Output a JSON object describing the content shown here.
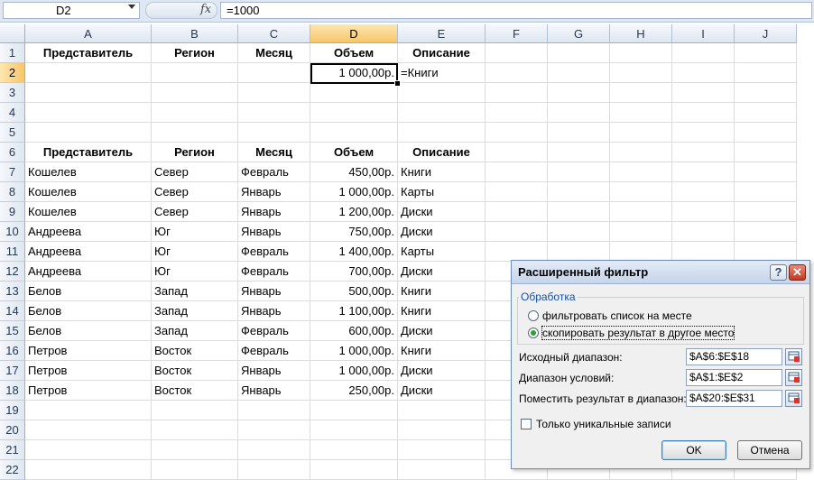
{
  "formula_bar": {
    "name_box": "D2",
    "fx_icon": "fx",
    "formula": "=1000"
  },
  "columns": [
    {
      "label": "A",
      "w": 140
    },
    {
      "label": "B",
      "w": 96
    },
    {
      "label": "C",
      "w": 80
    },
    {
      "label": "D",
      "w": 97
    },
    {
      "label": "E",
      "w": 97
    },
    {
      "label": "F",
      "w": 69
    },
    {
      "label": "G",
      "w": 69
    },
    {
      "label": "H",
      "w": 69
    },
    {
      "label": "I",
      "w": 69
    },
    {
      "label": "J",
      "w": 69
    }
  ],
  "active_column": "D",
  "active_row": 2,
  "rows": [
    {
      "num": "1",
      "bold": true,
      "cells": [
        "Представитель",
        "Регион",
        "Месяц",
        "Объем",
        "Описание"
      ]
    },
    {
      "num": "2",
      "cells": [
        "",
        "",
        "",
        "1 000,00р.",
        "=Книги"
      ]
    },
    {
      "num": "3",
      "cells": [
        "",
        "",
        "",
        "",
        ""
      ]
    },
    {
      "num": "4",
      "cells": [
        "",
        "",
        "",
        "",
        ""
      ]
    },
    {
      "num": "5",
      "cells": [
        "",
        "",
        "",
        "",
        ""
      ]
    },
    {
      "num": "6",
      "bold": true,
      "cells": [
        "Представитель",
        "Регион",
        "Месяц",
        "Объем",
        "Описание"
      ]
    },
    {
      "num": "7",
      "cells": [
        "Кошелев",
        "Север",
        "Февраль",
        "450,00р.",
        "Книги"
      ]
    },
    {
      "num": "8",
      "cells": [
        "Кошелев",
        "Север",
        "Январь",
        "1 000,00р.",
        "Карты"
      ]
    },
    {
      "num": "9",
      "cells": [
        "Кошелев",
        "Север",
        "Январь",
        "1 200,00р.",
        "Диски"
      ]
    },
    {
      "num": "10",
      "cells": [
        "Андреева",
        "Юг",
        "Январь",
        "750,00р.",
        "Диски"
      ]
    },
    {
      "num": "11",
      "cells": [
        "Андреева",
        "Юг",
        "Февраль",
        "1 400,00р.",
        "Карты"
      ]
    },
    {
      "num": "12",
      "cells": [
        "Андреева",
        "Юг",
        "Февраль",
        "700,00р.",
        "Диски"
      ]
    },
    {
      "num": "13",
      "cells": [
        "Белов",
        "Запад",
        "Январь",
        "500,00р.",
        "Книги"
      ]
    },
    {
      "num": "14",
      "cells": [
        "Белов",
        "Запад",
        "Январь",
        "1 100,00р.",
        "Книги"
      ]
    },
    {
      "num": "15",
      "cells": [
        "Белов",
        "Запад",
        "Февраль",
        "600,00р.",
        "Диски"
      ]
    },
    {
      "num": "16",
      "cells": [
        "Петров",
        "Восток",
        "Февраль",
        "1 000,00р.",
        "Книги"
      ]
    },
    {
      "num": "17",
      "cells": [
        "Петров",
        "Восток",
        "Январь",
        "1 000,00р.",
        "Диски"
      ]
    },
    {
      "num": "18",
      "cells": [
        "Петров",
        "Восток",
        "Январь",
        "250,00р.",
        "Диски"
      ]
    },
    {
      "num": "19",
      "cells": [
        "",
        "",
        "",
        "",
        ""
      ]
    },
    {
      "num": "20",
      "cells": [
        "",
        "",
        "",
        "",
        ""
      ]
    },
    {
      "num": "21",
      "cells": [
        "",
        "",
        "",
        "",
        ""
      ]
    },
    {
      "num": "22",
      "cells": [
        "",
        "",
        "",
        "",
        ""
      ]
    }
  ],
  "dialog": {
    "title": "Расширенный фильтр",
    "help_button": "?",
    "close_button": "✕",
    "group_label": "Обработка",
    "radio_filter_in_place": "фильтровать список на месте",
    "radio_copy_to": "скопировать результат в другое место",
    "selected_radio": "copy_to",
    "list_range_label": "Исходный диапазон:",
    "list_range_value": "$A$6:$E$18",
    "criteria_range_label": "Диапазон условий:",
    "criteria_range_value": "$A$1:$E$2",
    "copy_to_label": "Поместить результат в диапазон:",
    "copy_to_value": "$A$20:$E$31",
    "unique_records_label": "Только уникальные записи",
    "unique_records_checked": false,
    "ok_button": "OK",
    "cancel_button": "Отмена"
  }
}
